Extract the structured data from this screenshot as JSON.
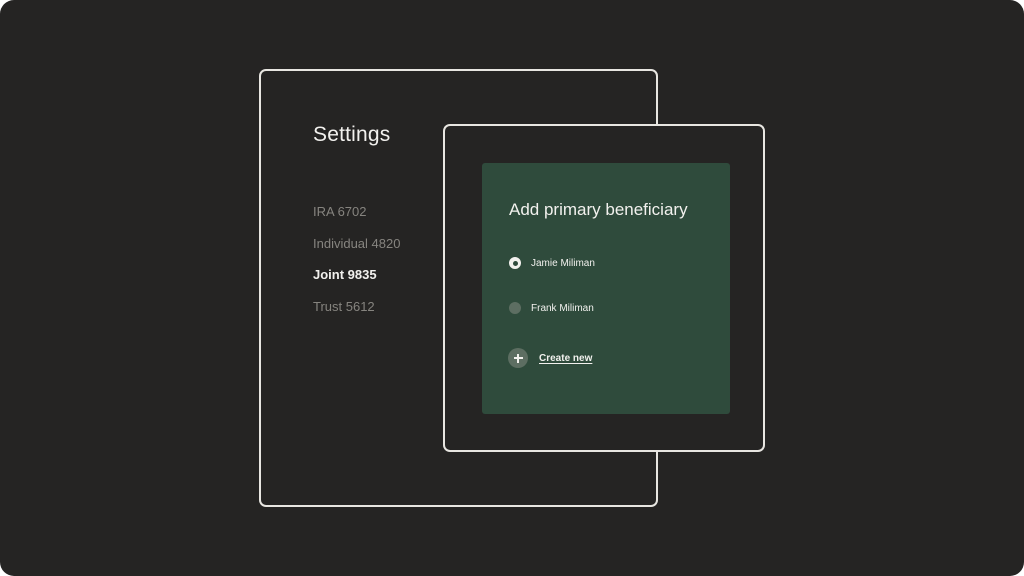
{
  "settings": {
    "title": "Settings",
    "accounts": [
      {
        "label": "IRA 6702",
        "active": false
      },
      {
        "label": "Individual 4820",
        "active": false
      },
      {
        "label": "Joint 9835",
        "active": true
      },
      {
        "label": "Trust 5612",
        "active": false
      }
    ]
  },
  "dialog": {
    "title": "Add primary beneficiary",
    "options": [
      {
        "label": "Jamie Miliman",
        "selected": true
      },
      {
        "label": "Frank Miliman",
        "selected": false
      }
    ],
    "create_label": "Create new",
    "create_icon": "plus-icon"
  },
  "colors": {
    "background": "#252423",
    "panel": "#2f4b3c",
    "border": "#e8e6e1",
    "text": "#f2f1ee",
    "muted_text": "#86847f",
    "icon_fill": "#5d6e62"
  }
}
